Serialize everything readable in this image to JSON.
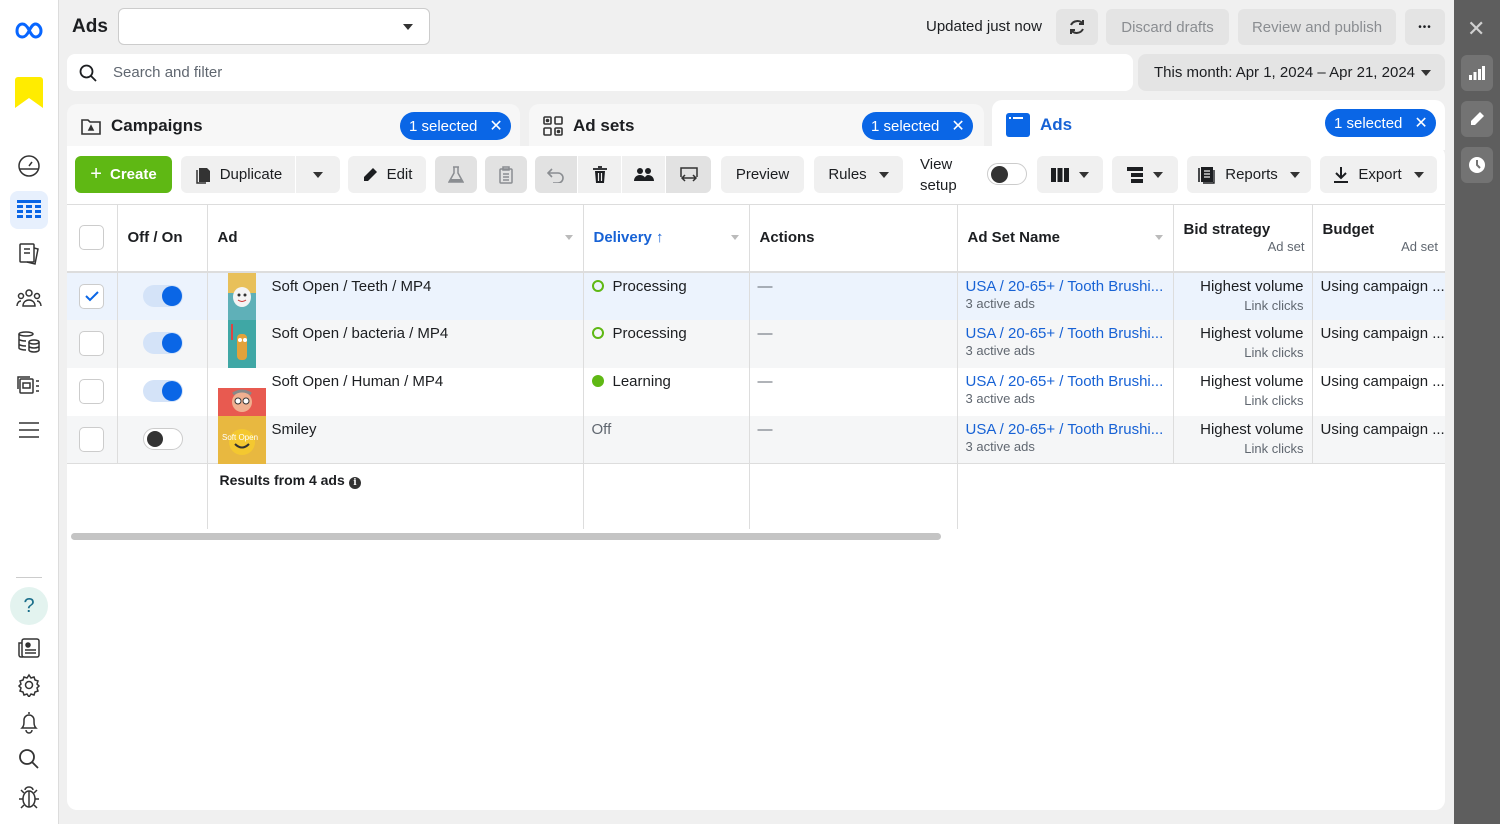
{
  "header": {
    "title": "Ads",
    "account_select_value": "",
    "updated_text": "Updated just now",
    "discard_label": "Discard drafts",
    "publish_label": "Review and publish",
    "more_label": "•••"
  },
  "search": {
    "placeholder": "Search and filter",
    "value": ""
  },
  "date_range": "This month: Apr 1, 2024 – Apr 21, 2024",
  "tabs": [
    {
      "label": "Campaigns",
      "badge": "1 selected",
      "icon": "campaign-folder-icon"
    },
    {
      "label": "Ad sets",
      "badge": "1 selected",
      "icon": "grid-icon"
    },
    {
      "label": "Ads",
      "badge": "1 selected",
      "icon": "ad-window-icon",
      "active": true
    }
  ],
  "toolbar": {
    "create": "Create",
    "duplicate": "Duplicate",
    "edit": "Edit",
    "preview": "Preview",
    "rules": "Rules",
    "view_setup": "View setup",
    "reports": "Reports",
    "export": "Export"
  },
  "table": {
    "columns": [
      {
        "label": "Off / On"
      },
      {
        "label": "Ad"
      },
      {
        "label": "Delivery ↑",
        "sorted": true
      },
      {
        "label": "Actions"
      },
      {
        "label": "Ad Set Name"
      },
      {
        "label": "Bid strategy",
        "sub": "Ad set"
      },
      {
        "label": "Budget",
        "sub": "Ad set"
      }
    ],
    "rows": [
      {
        "selected": true,
        "on": true,
        "name": "Soft Open / Teeth / MP4",
        "delivery": "Processing",
        "delivery_type": "processing",
        "actions": "—",
        "adset": "USA / 20-65+ / Tooth Brushi...",
        "adset_sub": "3 active ads",
        "bid": "Highest volume",
        "bid_sub": "Link clicks",
        "budget": "Using campaign ..."
      },
      {
        "selected": false,
        "on": true,
        "name": "Soft Open / bacteria / MP4",
        "delivery": "Processing",
        "delivery_type": "processing",
        "actions": "—",
        "adset": "USA / 20-65+ / Tooth Brushi...",
        "adset_sub": "3 active ads",
        "bid": "Highest volume",
        "bid_sub": "Link clicks",
        "budget": "Using campaign ..."
      },
      {
        "selected": false,
        "on": true,
        "name": "Soft Open / Human / MP4",
        "delivery": "Learning",
        "delivery_type": "learning",
        "actions": "—",
        "adset": "USA / 20-65+ / Tooth Brushi...",
        "adset_sub": "3 active ads",
        "bid": "Highest volume",
        "bid_sub": "Link clicks",
        "budget": "Using campaign ..."
      },
      {
        "selected": false,
        "on": false,
        "name": "Smiley",
        "delivery": "Off",
        "delivery_type": "off",
        "actions": "—",
        "adset": "USA / 20-65+ / Tooth Brushi...",
        "adset_sub": "3 active ads",
        "bid": "Highest volume",
        "bid_sub": "Link clicks",
        "budget": "Using campaign ..."
      }
    ],
    "summary": "Results from 4 ads"
  },
  "colors": {
    "accent": "#0a66e6",
    "create_green": "#5fb814",
    "link": "#1762d5",
    "status_green": "#5fb814"
  }
}
